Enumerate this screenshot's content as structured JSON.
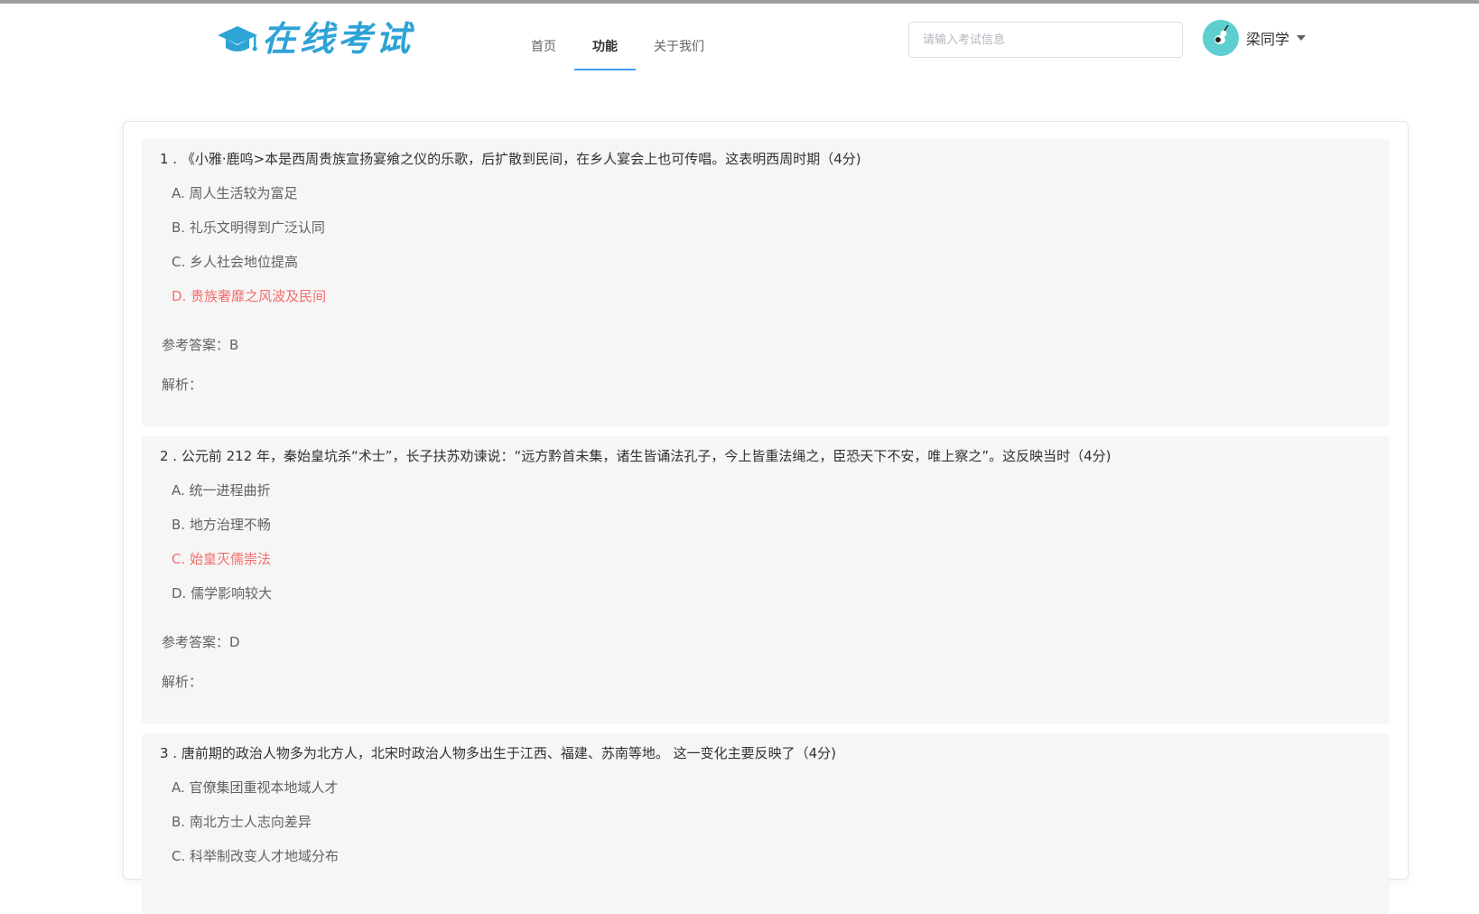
{
  "header": {
    "logo_text": "在线考试",
    "nav": [
      "首页",
      "功能",
      "关于我们"
    ],
    "active_nav": "功能",
    "search_placeholder": "请输入考试信息",
    "user_name": "梁同学"
  },
  "colors": {
    "accent": "#409eff",
    "logo": "#2ea3d6",
    "wrong_option": "#f56c6c",
    "question_bg": "#f6f6f6",
    "avatar_bg": "#5ecfd0"
  },
  "questions": [
    {
      "title": "1 . 《小雅·鹿鸣>本是西周贵族宣扬宴飨之仪的乐歌，后扩散到民间，在乡人宴会上也可传唱。这表明西周时期（4分)",
      "options": [
        "A. 周人生活较为富足",
        "B. 礼乐文明得到广泛认同",
        "C. 乡人社会地位提高",
        "D. 贵族奢靡之风波及民间"
      ],
      "selected": "D",
      "answer_label": "参考答案：B",
      "analysis_label": "解析："
    },
    {
      "title": "2 . 公元前 212 年，秦始皇坑杀“术士”，长子扶苏劝谏说：“远方黔首未集，诸生皆诵法孔子，今上皆重法绳之，臣恐天下不安，唯上察之”。这反映当时（4分)",
      "options": [
        "A. 统一进程曲折",
        "B. 地方治理不畅",
        "C. 始皇灭儒崇法",
        "D. 儒学影响较大"
      ],
      "selected": "C",
      "answer_label": "参考答案：D",
      "analysis_label": "解析："
    },
    {
      "title": "3 . 唐前期的政治人物多为北方人，北宋时政治人物多出生于江西、福建、苏南等地。 这一变化主要反映了（4分)",
      "options": [
        "A. 官僚集团重视本地域人才",
        "B. 南北方士人志向差异",
        "C. 科举制改变人才地域分布"
      ],
      "selected": "",
      "answer_label": "",
      "analysis_label": ""
    }
  ]
}
